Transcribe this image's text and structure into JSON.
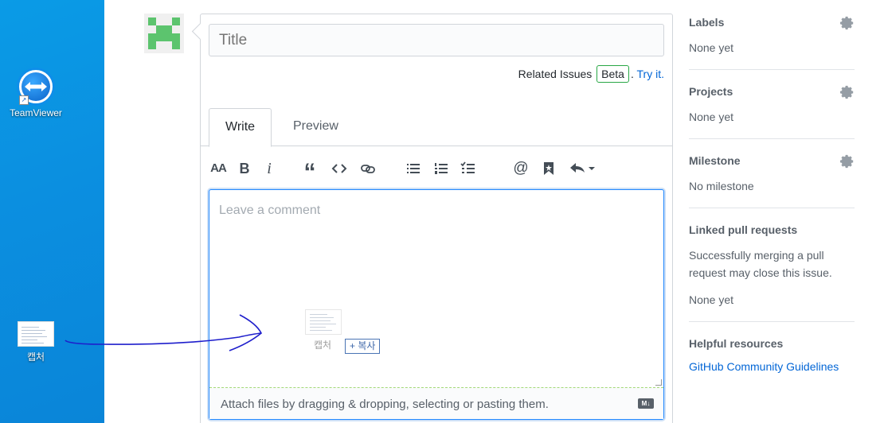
{
  "desktop": {
    "icons": [
      {
        "label": "TeamViewer"
      },
      {
        "label": "캡처"
      }
    ]
  },
  "editor": {
    "title_placeholder": "Title",
    "related_issues_label": "Related Issues",
    "beta_label": "Beta",
    "try_it_label": "Try it.",
    "tabs": [
      {
        "label": "Write",
        "active": true
      },
      {
        "label": "Preview",
        "active": false
      }
    ],
    "toolbar": {
      "heading_icon": "text-size-icon",
      "heading_label": "AA",
      "bold_label": "B",
      "italic_label": "i",
      "quote_label": "“",
      "mention_label": "@"
    },
    "comment_placeholder": "Leave a comment",
    "attach_text": "Attach files by dragging & dropping, selecting or pasting them.",
    "markdown_badge": "M↓"
  },
  "drag_ghost": {
    "label": "캡처",
    "copy_badge": "+ 복사"
  },
  "sidebar": {
    "sections": [
      {
        "title": "Labels",
        "value": "None yet"
      },
      {
        "title": "Projects",
        "value": "None yet"
      },
      {
        "title": "Milestone",
        "value": "No milestone"
      },
      {
        "title": "Linked pull requests",
        "description": "Successfully merging a pull request may close this issue.",
        "value": "None yet"
      },
      {
        "title": "Helpful resources",
        "link": "GitHub Community Guidelines"
      }
    ]
  },
  "colors": {
    "accent": "#0366d6",
    "beta_border": "#28a745",
    "focus_border": "#2188ff",
    "avatar": "#5cc46e",
    "desktop": "#0a8fe0",
    "annotation": "#1e1ecc"
  }
}
